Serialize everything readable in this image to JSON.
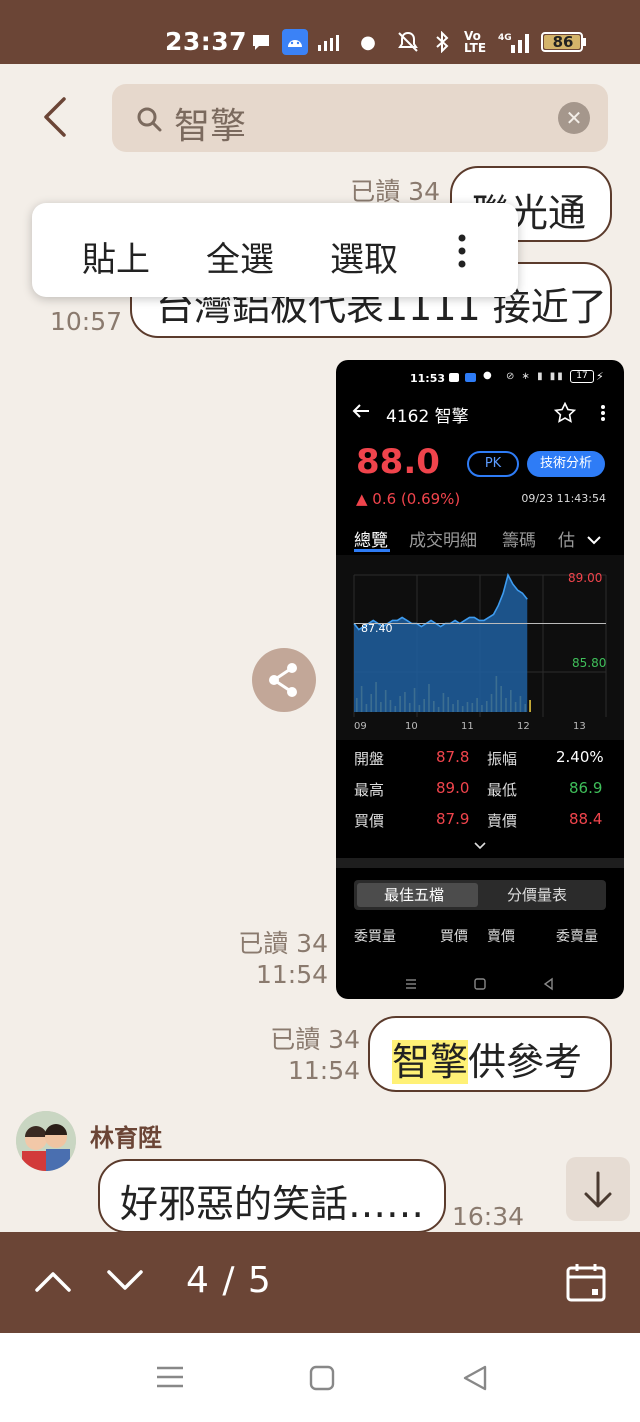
{
  "status_bar": {
    "time": "23:37",
    "battery": "86"
  },
  "search": {
    "query": "智擎"
  },
  "messages": {
    "m1": {
      "text": "聯光通",
      "read": "已讀 34"
    },
    "m2": {
      "text": "台灣鋁板代表1111 接近了",
      "time": "10:57"
    },
    "m3": {
      "read": "已讀 34",
      "time": "11:54"
    },
    "m4": {
      "highlight": "智擎",
      "rest": "供參考",
      "read": "已讀 34",
      "time": "11:54"
    },
    "m5": {
      "sender": "林育陞",
      "text": "好邪惡的笑話……",
      "time": "16:34"
    }
  },
  "context_menu": {
    "paste": "貼上",
    "select_all": "全選",
    "select": "選取"
  },
  "screenshot": {
    "status_time": "11:53",
    "battery": "17",
    "stock": "4162 智擎",
    "price": "88.0",
    "pk": "PK",
    "tech": "技術分析",
    "change": "▲ 0.6 (0.69%)",
    "datetime": "09/23 11:43:54",
    "tabs": [
      "總覽",
      "成交明細",
      "籌碼",
      "估"
    ],
    "chart": {
      "high_label": "89.00",
      "ref_label": "87.40",
      "low_label": "85.80",
      "x_labels": [
        "09",
        "10",
        "11",
        "12",
        "13"
      ]
    },
    "stats": {
      "open_label": "開盤",
      "open": "87.8",
      "amp_label": "振幅",
      "amp": "2.40%",
      "high_label": "最高",
      "high": "89.0",
      "low_label": "最低",
      "low": "86.9",
      "bid_label": "買價",
      "bid": "87.9",
      "ask_label": "賣價",
      "ask": "88.4"
    },
    "seg": [
      "最佳五檔",
      "分價量表"
    ],
    "orderbook_headers": [
      "委買量",
      "買價",
      "賣價",
      "委賣量"
    ]
  },
  "bottom_bar": {
    "counter": "4 / 5"
  },
  "chart_data": {
    "type": "line",
    "x": [
      "09",
      "10",
      "11",
      "12",
      "13"
    ],
    "ylim": [
      85.8,
      89.0
    ],
    "reference": 87.4,
    "series": [
      {
        "values": [
          87.4,
          87.2,
          87.3,
          87.4,
          87.5,
          87.4,
          87.3,
          87.4,
          87.5,
          87.5,
          87.6,
          87.5,
          87.4,
          87.4,
          87.3,
          87.4,
          87.5,
          87.4,
          87.3,
          87.4,
          87.4,
          87.5,
          87.4,
          87.5,
          87.6,
          87.6,
          87.5,
          87.5,
          87.6,
          87.7,
          88.0,
          88.4,
          89.0,
          88.7,
          88.5,
          88.4,
          88.2
        ]
      }
    ]
  },
  "colors": {
    "brand": "#6b4536",
    "up": "#f0444c",
    "down": "#3fbf5a",
    "accent": "#2e7cf6",
    "highlight": "#fff176"
  }
}
